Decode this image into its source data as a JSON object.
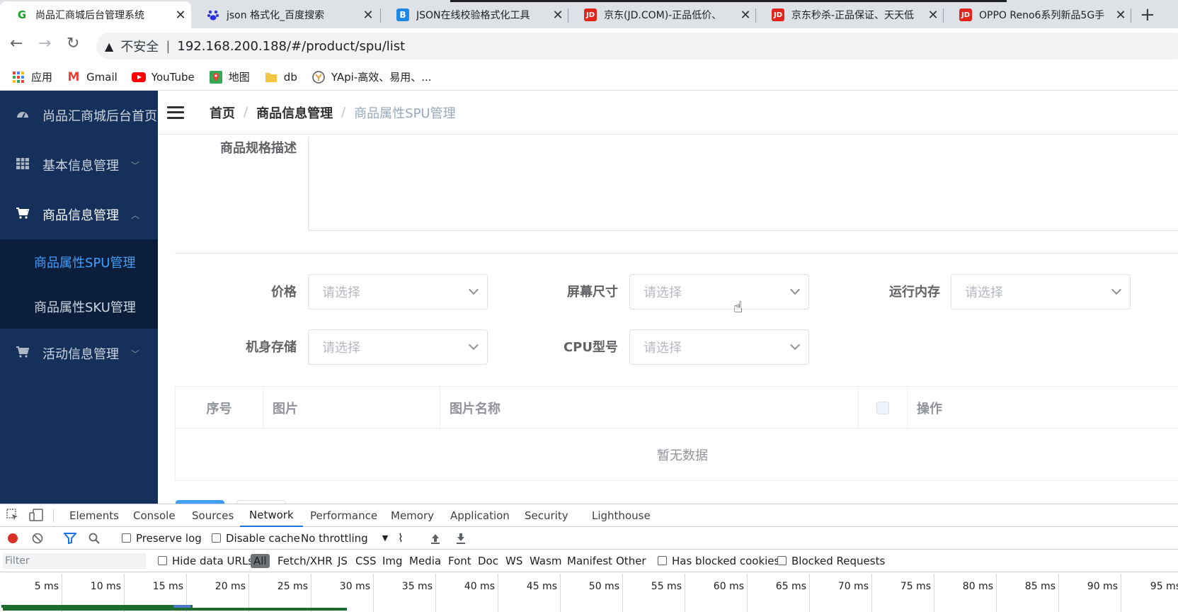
{
  "browser": {
    "tabs": [
      {
        "title": "尚品汇商城后台管理系统",
        "active": true,
        "favicon": "G",
        "favicon_color": "#1a9f29"
      },
      {
        "title": "json 格式化_百度搜索",
        "active": false,
        "favicon": "baidu-paw",
        "favicon_color": "#2932e1"
      },
      {
        "title": "JSON在线校验格式化工具",
        "active": false,
        "favicon": "B",
        "favicon_color": "#1e88e5"
      },
      {
        "title": "京东(JD.COM)-正品低价、",
        "active": false,
        "favicon": "JD",
        "favicon_color": "#e1251b"
      },
      {
        "title": "京东秒杀-正品保证、天天低",
        "active": false,
        "favicon": "JD",
        "favicon_color": "#e1251b"
      },
      {
        "title": "OPPO Reno6系列新品5G手",
        "active": false,
        "favicon": "JD",
        "favicon_color": "#e1251b"
      }
    ],
    "close_glyph": "✕",
    "new_tab_glyph": "+",
    "nav": {
      "back": "←",
      "forward": "→",
      "reload": "↻"
    },
    "address": {
      "insecure_label": "不安全",
      "url": "192.168.200.188/#/product/spu/list"
    },
    "bookmarks": [
      {
        "label": "应用",
        "icon": "apps-grid-icon"
      },
      {
        "label": "Gmail",
        "icon": "gmail-icon"
      },
      {
        "label": "YouTube",
        "icon": "youtube-icon"
      },
      {
        "label": "地图",
        "icon": "maps-icon"
      },
      {
        "label": "db",
        "icon": "folder-icon"
      },
      {
        "label": "YApi-高效、易用、...",
        "icon": "yapi-icon"
      }
    ]
  },
  "sidebar": {
    "home": "尚品汇商城后台首页",
    "menus": [
      {
        "label": "基本信息管理",
        "icon": "grid-icon",
        "expanded": false
      },
      {
        "label": "商品信息管理",
        "icon": "cart-icon",
        "expanded": true
      },
      {
        "label": "活动信息管理",
        "icon": "cart-icon",
        "expanded": false
      }
    ],
    "submenu": [
      {
        "label": "商品属性SPU管理",
        "active": true
      },
      {
        "label": "商品属性SKU管理",
        "active": false
      }
    ]
  },
  "breadcrumb": [
    "首页",
    "商品信息管理",
    "商品属性SPU管理"
  ],
  "form": {
    "spec_label": "商品规格描述",
    "attrs": [
      {
        "label": "价格",
        "placeholder": "请选择"
      },
      {
        "label": "屏幕尺寸",
        "placeholder": "请选择"
      },
      {
        "label": "运行内存",
        "placeholder": "请选择"
      },
      {
        "label": "机身存储",
        "placeholder": "请选择"
      },
      {
        "label": "CPU型号",
        "placeholder": "请选择"
      }
    ]
  },
  "table": {
    "columns": [
      "序号",
      "图片",
      "图片名称",
      "",
      "操作"
    ],
    "empty_text": "暂无数据"
  },
  "devtools": {
    "tabs": [
      "Elements",
      "Console",
      "Sources",
      "Network",
      "Performance",
      "Memory",
      "Application",
      "Security",
      "Lighthouse"
    ],
    "active_tab": "Network",
    "toolbar": {
      "preserve_log": "Preserve log",
      "disable_cache": "Disable cache",
      "throttling": "No throttling"
    },
    "filter": {
      "placeholder": "Filter",
      "hide_data_urls": "Hide data URLs",
      "types": [
        "All",
        "Fetch/XHR",
        "JS",
        "CSS",
        "Img",
        "Media",
        "Font",
        "Doc",
        "WS",
        "Wasm",
        "Manifest",
        "Other"
      ],
      "has_blocked_cookies": "Has blocked cookies",
      "blocked_requests": "Blocked Requests"
    },
    "timeline_ticks": [
      "5 ms",
      "10 ms",
      "15 ms",
      "20 ms",
      "25 ms",
      "30 ms",
      "35 ms",
      "40 ms",
      "45 ms",
      "50 ms",
      "55 ms",
      "60 ms",
      "65 ms",
      "70 ms",
      "75 ms",
      "80 ms",
      "85 ms",
      "90 ms",
      "95 ms"
    ]
  },
  "colors": {
    "sidebar_bg": "#15305a",
    "submenu_bg": "#0b1f3c",
    "active_link": "#409eff",
    "primary_button": "#409eff"
  }
}
